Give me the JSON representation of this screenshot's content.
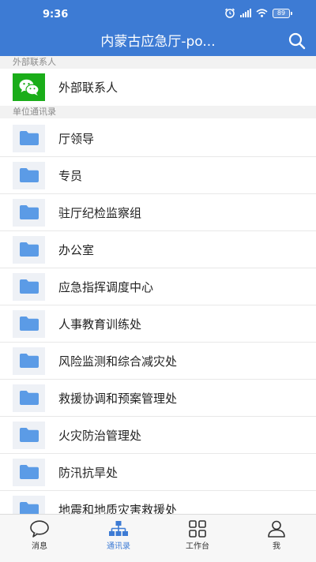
{
  "status_bar": {
    "time": "9:36",
    "battery": "89"
  },
  "header": {
    "title": "内蒙古应急厅-po..."
  },
  "external": {
    "section_label": "外部联系人",
    "item_label": "外部联系人"
  },
  "directory": {
    "section_label": "单位通讯录",
    "departments": [
      "厅领导",
      "专员",
      "驻厅纪检监察组",
      "办公室",
      "应急指挥调度中心",
      "人事教育训练处",
      "风险监测和综合减灾处",
      "救援协调和预案管理处",
      "火灾防治管理处",
      "防汛抗旱处",
      "地震和地质灾害救援处"
    ]
  },
  "tabbar": {
    "tabs": [
      {
        "label": "消息",
        "icon": "chat-bubble-icon"
      },
      {
        "label": "通讯录",
        "icon": "org-chart-icon",
        "active": true
      },
      {
        "label": "工作台",
        "icon": "grid-icon"
      },
      {
        "label": "我",
        "icon": "person-icon"
      }
    ]
  },
  "colors": {
    "primary": "#3d7bd4",
    "wechat": "#1aad19",
    "folder": "#5b9be6"
  }
}
